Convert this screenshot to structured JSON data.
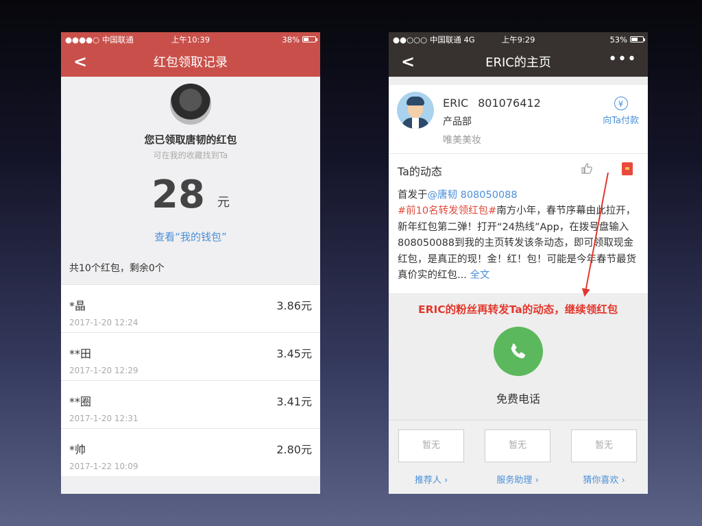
{
  "left_phone": {
    "status": {
      "carrier": "●●●●○ 中国联通",
      "time": "上午10:39",
      "battery": "38%",
      "battery_level": 0.38
    },
    "nav": {
      "back": "<",
      "title": "红包领取记录"
    },
    "header": {
      "avatar_alt": "avatar",
      "title": "您已领取唐韧的红包",
      "subtitle": "可在我的收藏找到Ta",
      "amount": "28",
      "unit": "元",
      "wallet_link": "查看“我的钱包”"
    },
    "summary": "共10个红包，剩余0个",
    "records": [
      {
        "name": "*晶",
        "amount": "3.86元",
        "time": "2017-1-20 12:24"
      },
      {
        "name": "**田",
        "amount": "3.45元",
        "time": "2017-1-20 12:29"
      },
      {
        "name": "**圈",
        "amount": "3.41元",
        "time": "2017-1-20 12:31"
      },
      {
        "name": "*帅",
        "amount": "2.80元",
        "time": "2017-1-22 10:09"
      }
    ]
  },
  "right_phone": {
    "status": {
      "carrier": "●●○○○ 中国联通 4G",
      "time": "上午9:29",
      "battery": "53%",
      "battery_level": 0.53
    },
    "nav": {
      "back": "<",
      "title": "ERIC的主页",
      "more": "•••"
    },
    "profile": {
      "name": "ERIC",
      "id": "801076412",
      "department": "产品部",
      "company": "唯美美妆",
      "pay_label": "向Ta付款",
      "pay_icon": "¥"
    },
    "feed": {
      "heading": "Ta的动态",
      "prefix": "首发于",
      "mention": "@唐韧 808050088",
      "tag": "#前10名转发领红包#",
      "text": "南方小年，春节序幕由此拉开，新年红包第二弹！打开“24热线”App，在拨号盘输入808050088到我的主页转发该条动态，即可领取现金红包，是真正的现！金！红！包！可能是今年春节最货真价实的红包...",
      "more": "全文"
    },
    "annotation": "ERIC的粉丝再转发Ta的动态，继续领红包",
    "call_label": "免费电话",
    "bottom": {
      "boxes": [
        "暂无",
        "暂无",
        "暂无"
      ],
      "links": [
        "推荐人 ›",
        "服务助理 ›",
        "猜你喜欢 ›"
      ]
    }
  },
  "colors": {
    "left_nav": "#c9504a",
    "right_nav": "#37322f",
    "link": "#4a8fd9",
    "annotation": "#e3372c",
    "call": "#5cb85c"
  }
}
